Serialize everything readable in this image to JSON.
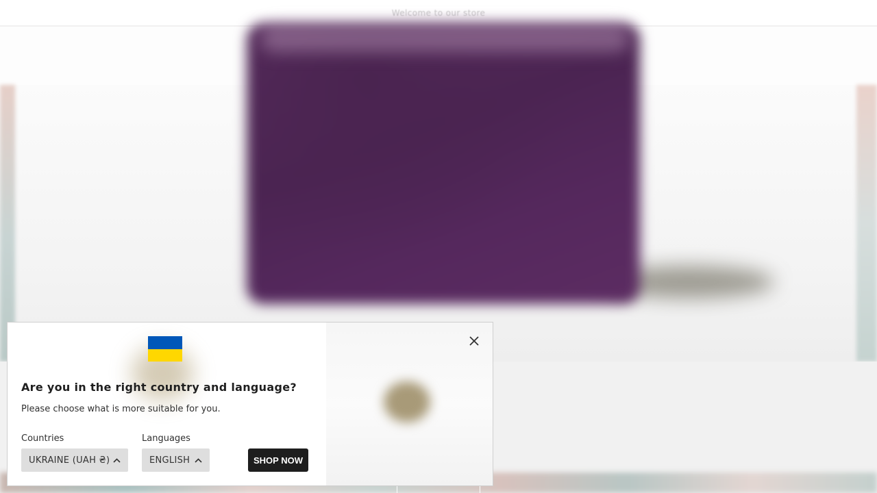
{
  "announcement": {
    "text": "Welcome to our store"
  },
  "popup": {
    "flag": {
      "country": "Ukraine",
      "top_color": "#0057b8",
      "bottom_color": "#ffd700"
    },
    "close_icon": "close-icon",
    "title": "Are you in the right country and language?",
    "subtitle": "Please choose what is more suitable for you.",
    "countries": {
      "label": "Countries",
      "selected": "UKRAINE (UAH ₴)",
      "icon": "chevron-up-icon"
    },
    "languages": {
      "label": "Languages",
      "selected": "ENGLISH",
      "icon": "chevron-up-icon"
    },
    "shop_button": {
      "label": "SHOP NOW",
      "background": "#1e1e1e"
    }
  },
  "colors": {
    "product": "#4e2656",
    "page_background": "#f3f2f1"
  }
}
